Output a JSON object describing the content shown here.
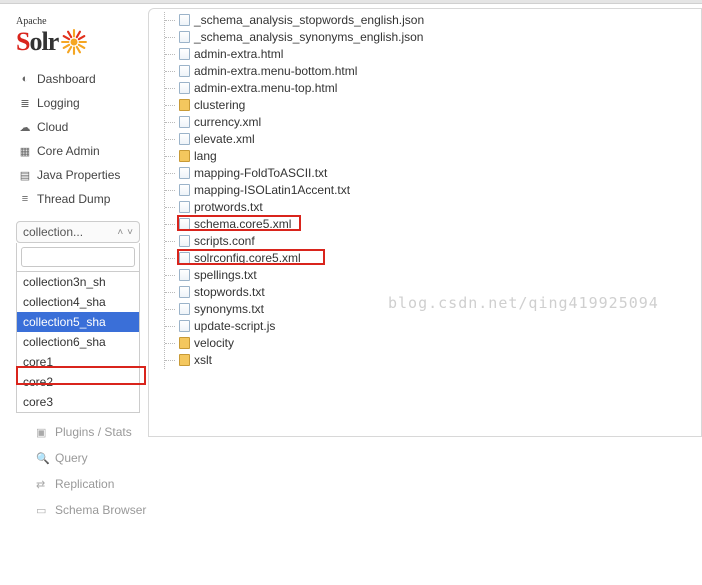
{
  "logo": {
    "top": "Apache",
    "main_s": "S",
    "main_rest": "olr"
  },
  "nav": [
    {
      "icon": "dashboard-icon",
      "glyph": "◐",
      "label": "Dashboard"
    },
    {
      "icon": "logging-icon",
      "glyph": "≣",
      "label": "Logging"
    },
    {
      "icon": "cloud-icon",
      "glyph": "☁",
      "label": "Cloud"
    },
    {
      "icon": "core-admin-icon",
      "glyph": "▦",
      "label": "Core Admin"
    },
    {
      "icon": "java-props-icon",
      "glyph": "▤",
      "label": "Java Properties"
    },
    {
      "icon": "thread-dump-icon",
      "glyph": "≡",
      "label": "Thread Dump"
    }
  ],
  "selector": {
    "placeholder": "collection...",
    "search_placeholder": "",
    "items": [
      {
        "label": "collection3n_sh",
        "selected": false
      },
      {
        "label": "collection4_sha",
        "selected": false
      },
      {
        "label": "collection5_sha",
        "selected": true
      },
      {
        "label": "collection6_sha",
        "selected": false
      },
      {
        "label": "core1",
        "selected": false
      },
      {
        "label": "core2",
        "selected": false
      },
      {
        "label": "core3",
        "selected": false
      }
    ]
  },
  "subnav": [
    {
      "icon": "plugins-icon",
      "glyph": "▣",
      "label": "Plugins / Stats"
    },
    {
      "icon": "query-icon",
      "glyph": "🔍",
      "label": "Query"
    },
    {
      "icon": "replication-icon",
      "glyph": "⇄",
      "label": "Replication"
    },
    {
      "icon": "schema-icon",
      "glyph": "▭",
      "label": "Schema Browser"
    }
  ],
  "tree": [
    {
      "type": "file",
      "name": "_schema_analysis_stopwords_english.json"
    },
    {
      "type": "file",
      "name": "_schema_analysis_synonyms_english.json"
    },
    {
      "type": "file",
      "name": "admin-extra.html"
    },
    {
      "type": "file",
      "name": "admin-extra.menu-bottom.html"
    },
    {
      "type": "file",
      "name": "admin-extra.menu-top.html"
    },
    {
      "type": "folder",
      "name": "clustering"
    },
    {
      "type": "file",
      "name": "currency.xml"
    },
    {
      "type": "file",
      "name": "elevate.xml"
    },
    {
      "type": "folder",
      "name": "lang"
    },
    {
      "type": "file",
      "name": "mapping-FoldToASCII.txt"
    },
    {
      "type": "file",
      "name": "mapping-ISOLatin1Accent.txt"
    },
    {
      "type": "file",
      "name": "protwords.txt"
    },
    {
      "type": "file",
      "name": "schema.core5.xml",
      "highlighted": true
    },
    {
      "type": "file",
      "name": "scripts.conf"
    },
    {
      "type": "file",
      "name": "solrconfig.core5.xml",
      "highlighted": true
    },
    {
      "type": "file",
      "name": "spellings.txt"
    },
    {
      "type": "file",
      "name": "stopwords.txt"
    },
    {
      "type": "file",
      "name": "synonyms.txt"
    },
    {
      "type": "file",
      "name": "update-script.js"
    },
    {
      "type": "folder",
      "name": "velocity"
    },
    {
      "type": "folder",
      "name": "xslt"
    }
  ],
  "watermark": "blog.csdn.net/qing419925094"
}
